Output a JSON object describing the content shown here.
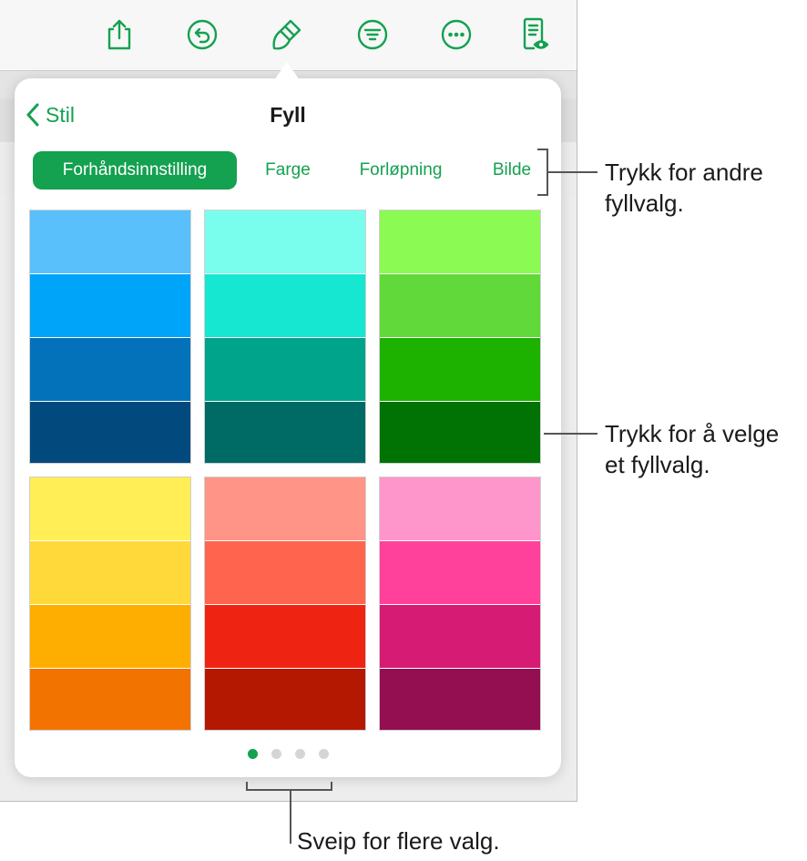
{
  "toolbar": {
    "icons": [
      "share-icon",
      "undo-icon",
      "format-brush-icon",
      "view-options-icon",
      "more-icon",
      "reading-view-icon"
    ]
  },
  "popover": {
    "back_label": "Stil",
    "title": "Fyll",
    "tabs": [
      {
        "label": "Forhåndsinnstilling",
        "selected": true
      },
      {
        "label": "Farge",
        "selected": false
      },
      {
        "label": "Forløpning",
        "selected": false
      },
      {
        "label": "Bilde",
        "selected": false
      }
    ],
    "swatches": [
      {
        "name": "blue",
        "colors": [
          "#5ac0fb",
          "#00a4f9",
          "#0372ba",
          "#024a7e"
        ]
      },
      {
        "name": "teal",
        "colors": [
          "#79fdec",
          "#15e7d0",
          "#00a48b",
          "#006a64"
        ]
      },
      {
        "name": "green",
        "colors": [
          "#8bfa53",
          "#62d93a",
          "#1db200",
          "#017304"
        ]
      },
      {
        "name": "yellow",
        "colors": [
          "#ffee55",
          "#ffd93a",
          "#feae00",
          "#f27300"
        ]
      },
      {
        "name": "red",
        "colors": [
          "#ff9487",
          "#ff644f",
          "#ef2311",
          "#b51800"
        ]
      },
      {
        "name": "pink",
        "colors": [
          "#ff96cb",
          "#ff419b",
          "#d61b74",
          "#930f51"
        ]
      }
    ],
    "page_dots": {
      "count": 4,
      "current": 1
    }
  },
  "callouts": {
    "tabs": [
      "Trykk for andre",
      "fyllvalg."
    ],
    "swatches": [
      "Trykk for å velge",
      "et fyllvalg."
    ],
    "dots": [
      "Sveip for flere valg."
    ]
  },
  "colors": {
    "accent": "#14a150"
  }
}
